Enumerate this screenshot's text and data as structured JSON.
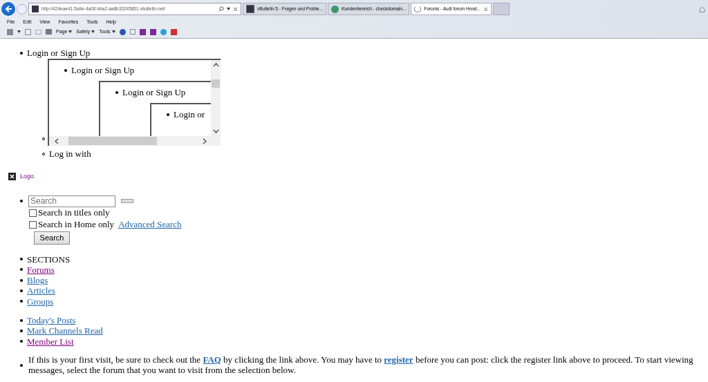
{
  "browser": {
    "address": "http://424eae41-5a9e-4a00-bba2-aa8b33245851.vbulletin.net/",
    "tabs": [
      {
        "label": "vBulletin 5 - Fragen und Proble...",
        "selected": false,
        "kind": "vb"
      },
      {
        "label": "Kundenbereich - checkdomain...",
        "selected": false,
        "kind": "check"
      },
      {
        "label": "Forums - Audi forum Hrvat...",
        "selected": true,
        "kind": "loading"
      }
    ],
    "menu": [
      "File",
      "Edit",
      "View",
      "Favorites",
      "Tools",
      "Help"
    ],
    "toolbar": [
      "Page",
      "Safety",
      "Tools"
    ]
  },
  "login": {
    "label": "Login or Sign Up",
    "nested": [
      "Login or Sign Up",
      "Login or Sign Up",
      "Login or"
    ],
    "login_with": "Log in with"
  },
  "logo": {
    "label": "Logo"
  },
  "search": {
    "placeholder": "Search",
    "options": [
      {
        "label": "Search in titles only",
        "checked": false
      },
      {
        "label": "Search in Home only",
        "checked": false
      }
    ],
    "advanced": "Advanced Search",
    "button": "Search"
  },
  "sections": {
    "heading": "SECTIONS",
    "links": [
      {
        "label": "Forums",
        "visited": true
      },
      {
        "label": "Blogs",
        "visited": false
      },
      {
        "label": "Articles",
        "visited": false
      },
      {
        "label": "Groups",
        "visited": false
      }
    ]
  },
  "quick_links": [
    {
      "label": "Today's Posts",
      "visited": false
    },
    {
      "label": "Mark Channels Read",
      "visited": false
    },
    {
      "label": "Member List",
      "visited": true
    }
  ],
  "notice": {
    "before": "If this is your first visit, be sure to check out the ",
    "faq": "FAQ",
    "middle": " by clicking the link above. You may have to ",
    "register": "register",
    "after": " before you can post: click the register link above to proceed. To start viewing messages, select the forum that you want to visit from the selection below."
  }
}
